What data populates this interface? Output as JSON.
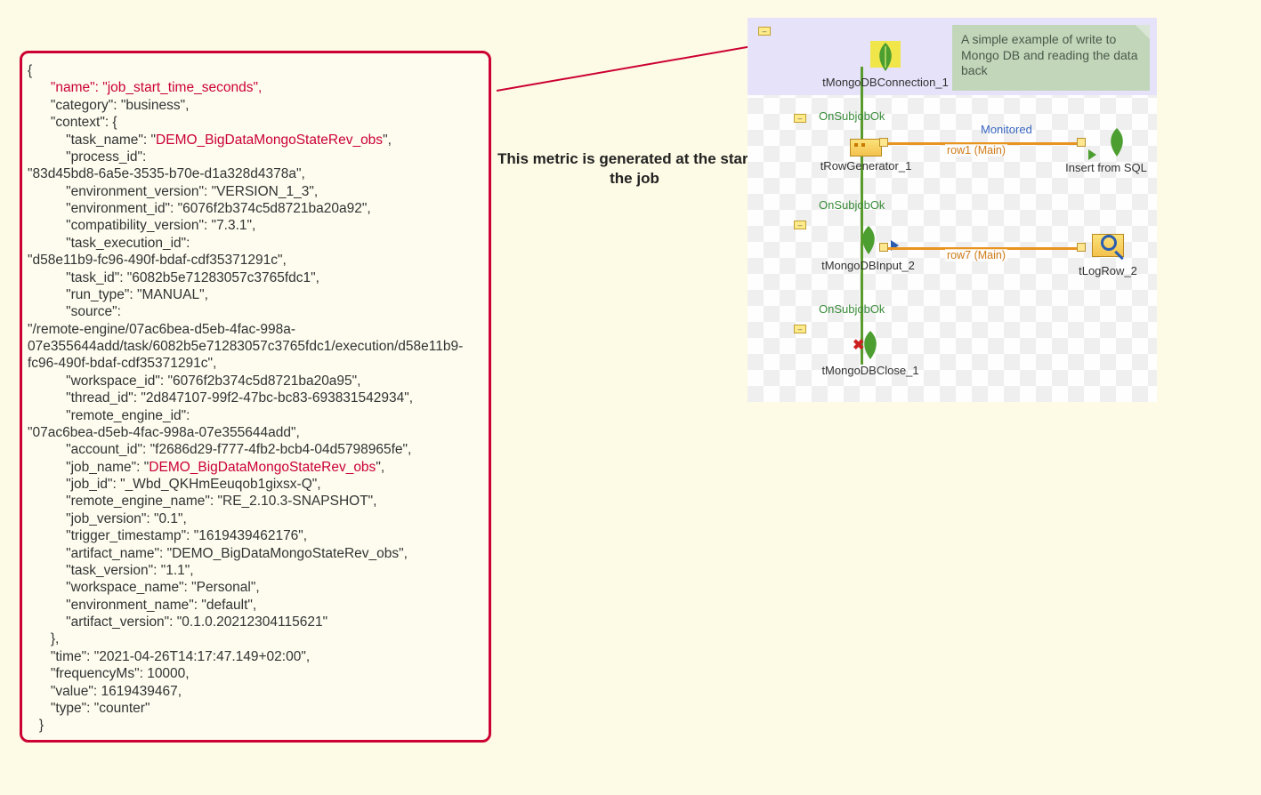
{
  "caption": "This metric is generated at the start of the job",
  "note": "A simple example of write to Mongo DB and reading the data back",
  "json_lines": [
    {
      "t": "{",
      "i": 0
    },
    {
      "t": "\"name\": \"job_start_time_seconds\",",
      "i": 2,
      "hl": true
    },
    {
      "t": "\"category\": \"business\",",
      "i": 2
    },
    {
      "t": "\"context\": {",
      "i": 2
    },
    {
      "t": "\"task_name\": \"",
      "post": "DEMO_BigDataMongoStateRev_obs",
      "postHl": true,
      "tail": "\",",
      "i": 3
    },
    {
      "t": "\"process_id\":",
      "i": 3
    },
    {
      "t": "\"83d45bd8-6a5e-3535-b70e-d1a328d4378a\",",
      "i": 0
    },
    {
      "t": "\"environment_version\": \"VERSION_1_3\",",
      "i": 3
    },
    {
      "t": "\"environment_id\": \"6076f2b374c5d8721ba20a92\",",
      "i": 3
    },
    {
      "t": "\"compatibility_version\": \"7.3.1\",",
      "i": 3
    },
    {
      "t": "\"task_execution_id\":",
      "i": 3
    },
    {
      "t": "\"d58e11b9-fc96-490f-bdaf-cdf35371291c\",",
      "i": 0
    },
    {
      "t": "\"task_id\": \"6082b5e71283057c3765fdc1\",",
      "i": 3
    },
    {
      "t": "\"run_type\": \"MANUAL\",",
      "i": 3
    },
    {
      "t": "\"source\":",
      "i": 3
    },
    {
      "t": "\"/remote-engine/07ac6bea-d5eb-4fac-998a-07e355644add/task/6082b5e71283057c3765fdc1/execution/d58e11b9-fc96-490f-bdaf-cdf35371291c\",",
      "i": 0,
      "wrap": true
    },
    {
      "t": "\"workspace_id\": \"6076f2b374c5d8721ba20a95\",",
      "i": 3
    },
    {
      "t": "\"thread_id\": \"2d847107-99f2-47bc-bc83-693831542934\",",
      "i": 3
    },
    {
      "t": "\"remote_engine_id\":",
      "i": 3
    },
    {
      "t": "\"07ac6bea-d5eb-4fac-998a-07e355644add\",",
      "i": 0
    },
    {
      "t": "\"account_id\": \"f2686d29-f777-4fb2-bcb4-04d5798965fe\",",
      "i": 3
    },
    {
      "t": "\"job_name\": \"",
      "post": "DEMO_BigDataMongoStateRev_obs",
      "postHl": true,
      "tail": "\",",
      "i": 3
    },
    {
      "t": "\"job_id\": \"_Wbd_QKHmEeuqob1gixsx-Q\",",
      "i": 3
    },
    {
      "t": "\"remote_engine_name\": \"RE_2.10.3-SNAPSHOT\",",
      "i": 3
    },
    {
      "t": "\"job_version\": \"0.1\",",
      "i": 3
    },
    {
      "t": "\"trigger_timestamp\": \"1619439462176\",",
      "i": 3
    },
    {
      "t": "\"artifact_name\": \"DEMO_BigDataMongoStateRev_obs\",",
      "i": 3
    },
    {
      "t": "\"task_version\": \"1.1\",",
      "i": 3
    },
    {
      "t": "\"workspace_name\": \"Personal\",",
      "i": 3
    },
    {
      "t": "\"environment_name\": \"default\",",
      "i": 3
    },
    {
      "t": "\"artifact_version\": \"0.1.0.20212304115621\"",
      "i": 3
    },
    {
      "t": "},",
      "i": 2
    },
    {
      "t": "\"time\": \"2021-04-26T14:17:47.149+02:00\",",
      "i": 2
    },
    {
      "t": "\"frequencyMs\": 10000,",
      "i": 2
    },
    {
      "t": "\"value\": 1619439467,",
      "i": 2
    },
    {
      "t": "\"type\": \"counter\"",
      "i": 2
    },
    {
      "t": "}",
      "i": 1
    }
  ],
  "diagram": {
    "nodes": {
      "mongoConn": "tMongoDBConnection_1",
      "rowGen": "tRowGenerator_1",
      "insert": "Insert from SQL",
      "mongoInput": "tMongoDBInput_2",
      "logRow": "tLogRow_2",
      "mongoClose": "tMongoDBClose_1"
    },
    "triggers": {
      "t1": "OnSubjobOk",
      "t2": "OnSubjobOk",
      "t3": "OnSubjobOk"
    },
    "flows": {
      "row1": "row1 (Main)",
      "row7": "row7 (Main)",
      "monitored": "Monitored"
    }
  }
}
